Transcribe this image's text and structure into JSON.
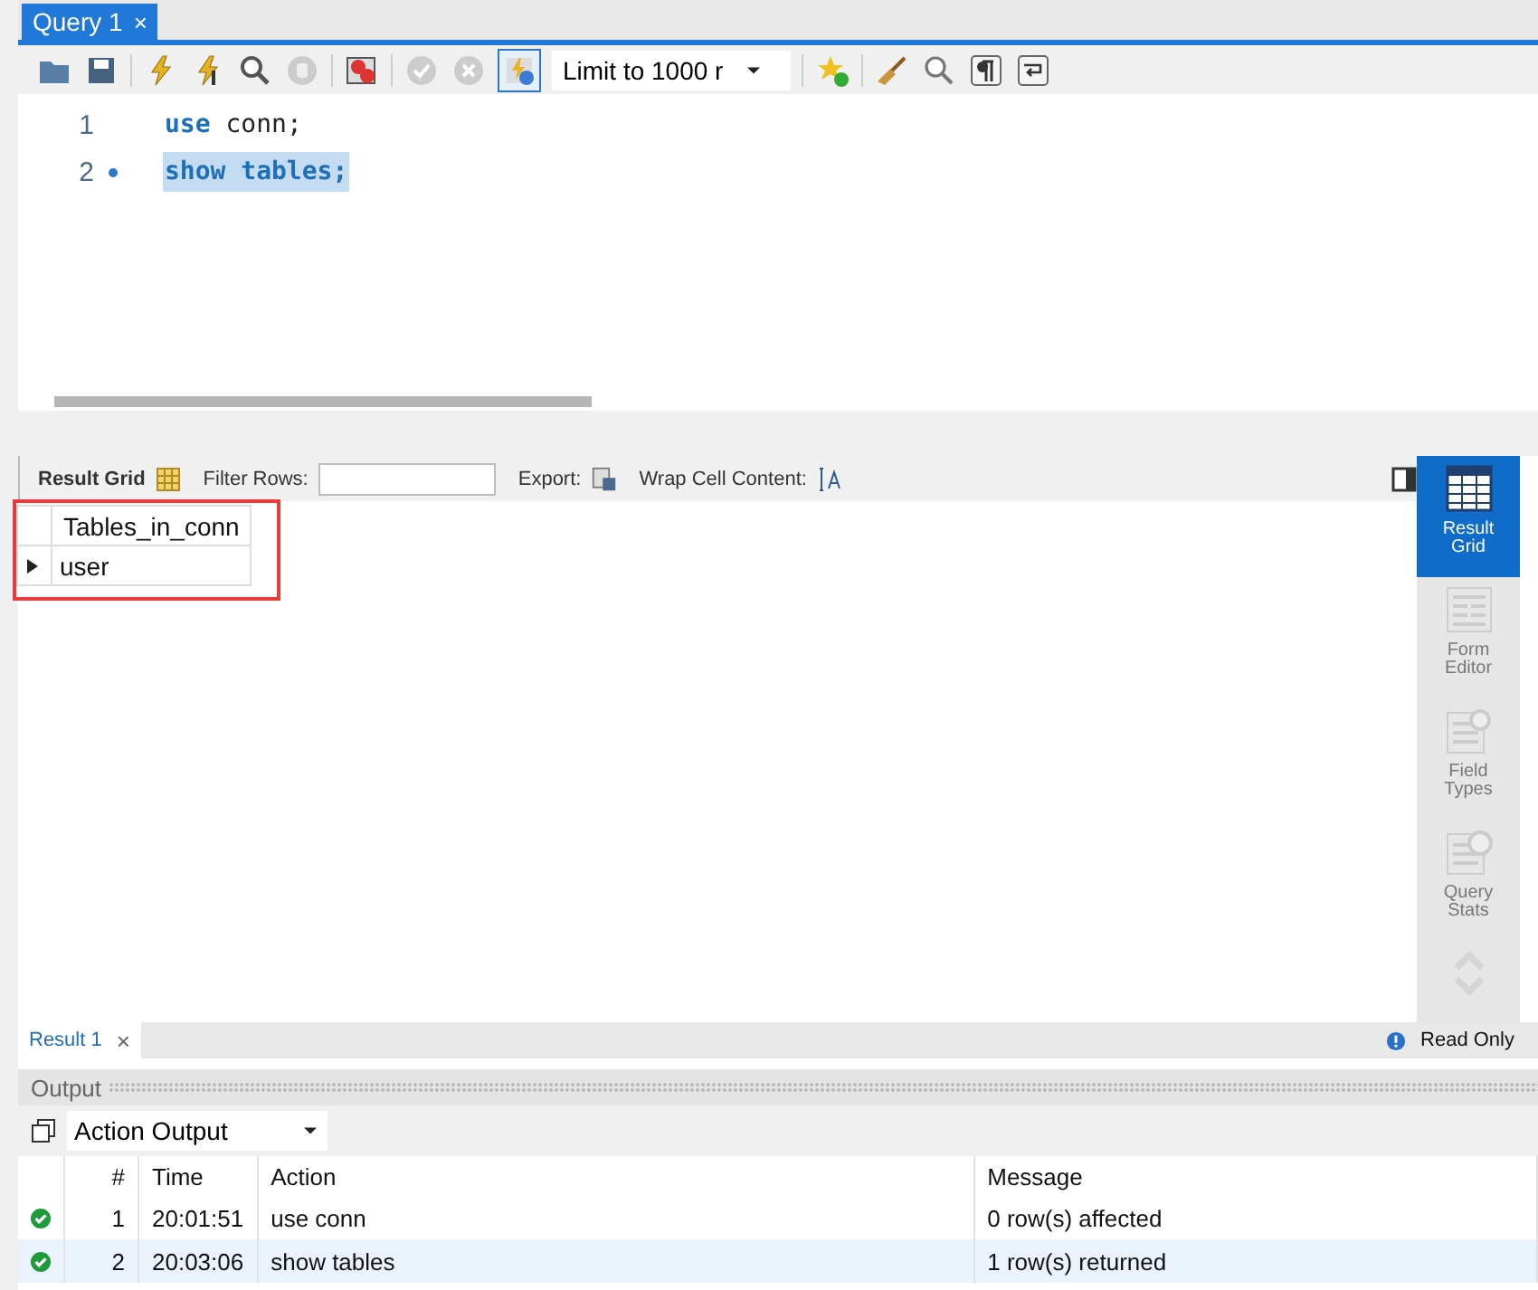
{
  "query_tabs": [
    {
      "label": "Query 1",
      "close": "×",
      "selected": true
    }
  ],
  "toolbar": {
    "toggle_pressed": true,
    "limit": "Limit to 1000 r"
  },
  "editor": {
    "lines": [
      {
        "number": "1",
        "marker": false,
        "selected": false,
        "tokens": [
          {
            "text": "use",
            "kind": "keyword"
          },
          {
            "text": " conn;",
            "kind": "plain"
          }
        ]
      },
      {
        "number": "2",
        "marker": true,
        "selected": true,
        "tokens": [
          {
            "text": "show tables;",
            "kind": "keyword"
          }
        ]
      }
    ]
  },
  "result_toolbar": {
    "result_grid": "Result Grid",
    "filter_label": "Filter Rows:",
    "export_label": "Export:",
    "wrap_label": "Wrap Cell Content:"
  },
  "grid": {
    "highlighted": true,
    "columns": [
      "Tables_in_conn"
    ],
    "rows": [
      {
        "cells": [
          "user"
        ],
        "current": true
      }
    ]
  },
  "side_panel": [
    {
      "label": "Result Grid",
      "kind": "grid",
      "selected": true
    },
    {
      "label": "Form Editor",
      "kind": "form",
      "selected": false
    },
    {
      "label": "Field Types",
      "kind": "fields",
      "selected": false
    },
    {
      "label": "Query Stats",
      "kind": "stats",
      "selected": false
    }
  ],
  "result_tabs": [
    {
      "label": "Result 1",
      "close": "×",
      "selected": true
    }
  ],
  "read_only": "Read Only",
  "output": {
    "title": "Output",
    "selector": "Action Output",
    "columns": [
      "#",
      "Time",
      "Action",
      "Message"
    ],
    "rows": [
      {
        "succeeded": true,
        "selected": false,
        "cells": [
          "1",
          "20:01:51",
          "use conn",
          "0 row(s) affected"
        ]
      },
      {
        "succeeded": true,
        "selected": true,
        "cells": [
          "2",
          "20:03:06",
          "show tables",
          "1 row(s) returned"
        ]
      }
    ]
  }
}
